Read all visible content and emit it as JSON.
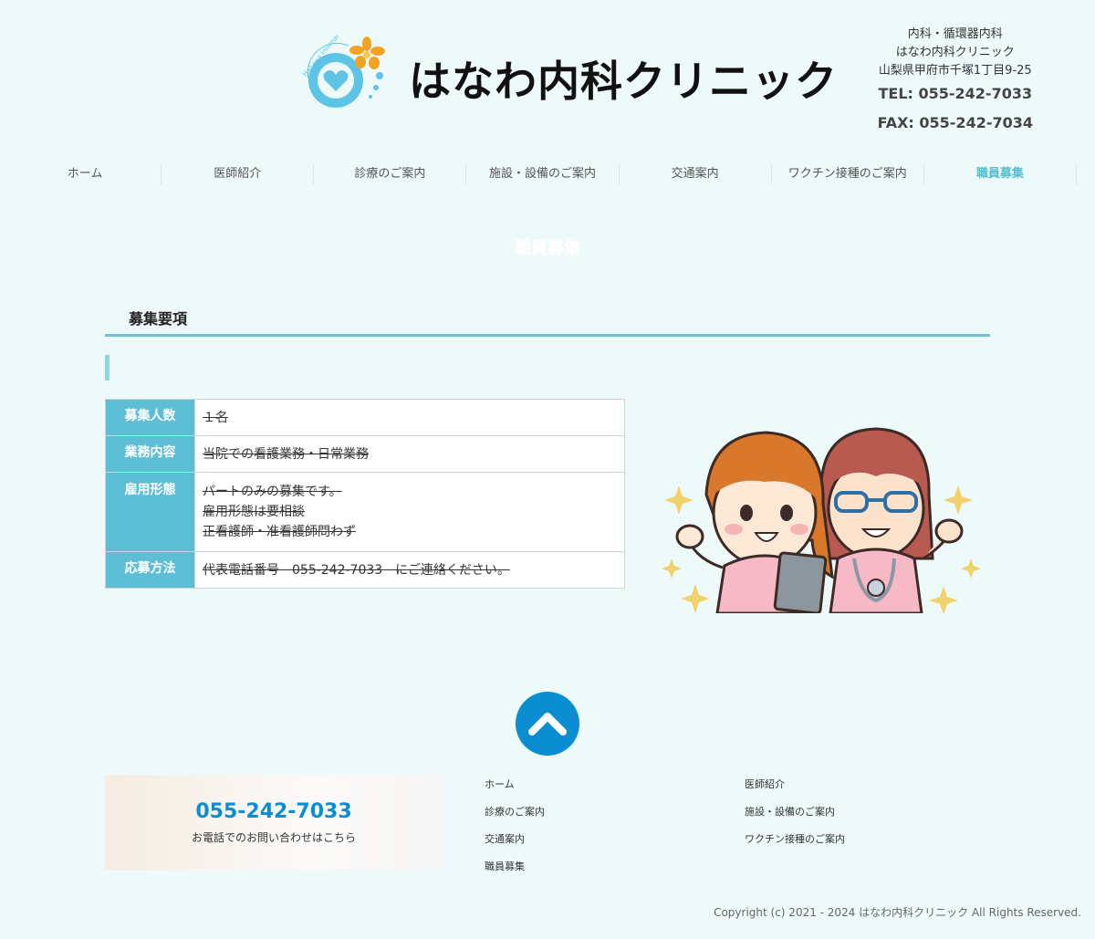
{
  "header": {
    "logo_text": "はなわ内科クリニック",
    "logo_arc_text": "Hanawa Internal Medicine Clinic",
    "departments": "内科・循環器内科",
    "clinic_name": "はなわ内科クリニック",
    "address": "山梨県甲府市千塚1丁目9-25",
    "tel": "TEL: 055-242-7033",
    "fax": "FAX: 055-242-7034"
  },
  "nav": {
    "items": [
      "ホーム",
      "医師紹介",
      "診療のご案内",
      "施設・設備のご案内",
      "交通案内",
      "ワクチン接種のご案内",
      "職員募集"
    ],
    "active": "職員募集"
  },
  "page": {
    "ghost_title": "職員募集",
    "section_title": "募集要項"
  },
  "requirements": [
    {
      "label": "募集人数",
      "lines": [
        "１名"
      ]
    },
    {
      "label": "業務内容",
      "lines": [
        "当院での看護業務・日常業務"
      ]
    },
    {
      "label": "雇用形態",
      "lines": [
        "パートのみの募集です。",
        "雇用形態は要相談",
        "正看護師・准看護師問わず"
      ]
    },
    {
      "label": "応募方法",
      "lines": [
        "代表電話番号　055-242-7033　にご連絡ください。"
      ]
    }
  ],
  "footer": {
    "phone": "055-242-7033",
    "phone_note": "お電話でのお問い合わせはこちら",
    "links_col1": [
      "ホーム",
      "診療のご案内",
      "交通案内",
      "職員募集"
    ],
    "links_col2": [
      "医師紹介",
      "施設・設備のご案内",
      "ワクチン接種のご案内"
    ],
    "copyright": "Copyright (c) 2021 - 2024 はなわ内科クリニック All Rights Reserved."
  },
  "colors": {
    "background": "#eefaf9",
    "accent": "#5dbfd6",
    "nav_active": "#55bfd0",
    "to_top": "#0a8ed1"
  },
  "icons": [
    "clinic-logo-icon",
    "chevron-up-icon"
  ]
}
